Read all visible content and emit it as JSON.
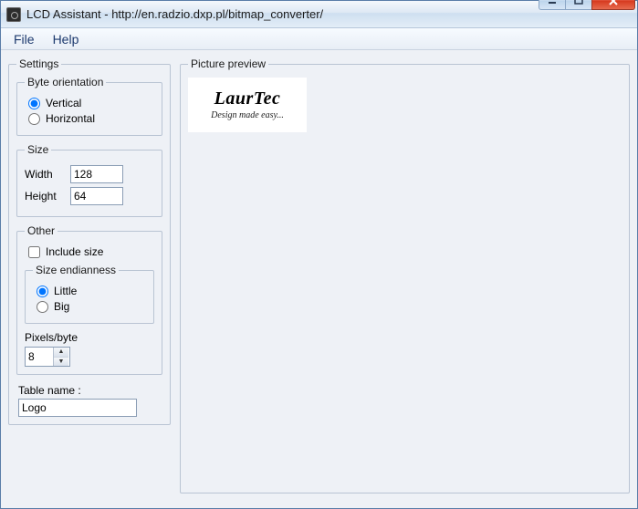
{
  "window": {
    "title": "LCD Assistant -  http://en.radzio.dxp.pl/bitmap_converter/"
  },
  "menu": {
    "file": "File",
    "help": "Help"
  },
  "settings": {
    "legend": "Settings",
    "byte_orientation": {
      "legend": "Byte orientation",
      "vertical": "Vertical",
      "horizontal": "Horizontal",
      "selected": "vertical"
    },
    "size": {
      "legend": "Size",
      "width_label": "Width",
      "height_label": "Height",
      "width": "128",
      "height": "64"
    },
    "other": {
      "legend": "Other",
      "include_size_label": "Include size",
      "include_size_checked": false,
      "endianness": {
        "legend": "Size endianness",
        "little": "Little",
        "big": "Big",
        "selected": "little"
      },
      "pixels_per_byte_label": "Pixels/byte",
      "pixels_per_byte": "8"
    },
    "table_name_label": "Table name :",
    "table_name": "Logo"
  },
  "preview": {
    "legend": "Picture preview",
    "brand": "LaurTec",
    "tagline": "Design made easy..."
  }
}
